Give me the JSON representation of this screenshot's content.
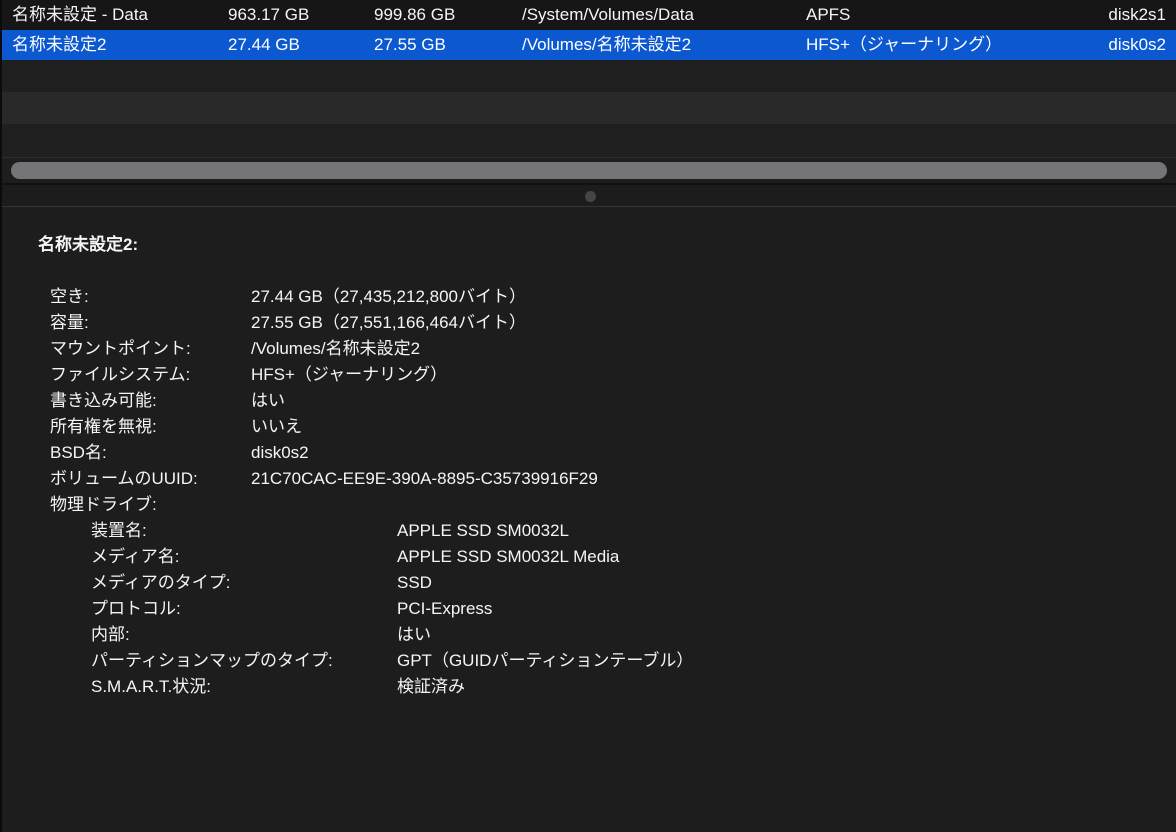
{
  "colors": {
    "selection_blue": "#0b58d0",
    "pane_background": "#1d1d1e",
    "stripe_dark": "#1f1f20",
    "stripe_light": "#29292a",
    "scrollbar_thumb": "#757577",
    "text": "#f5f5f5"
  },
  "table": {
    "rows": [
      {
        "name": "名称未設定 - Data",
        "free": "963.17 GB",
        "capacity": "999.86 GB",
        "mount_point": "/System/Volumes/Data",
        "file_system": "APFS",
        "bsd_name": "disk2s1",
        "selected": false
      },
      {
        "name": "名称未設定2",
        "free": "27.44 GB",
        "capacity": "27.55 GB",
        "mount_point": "/Volumes/名称未設定2",
        "file_system": "HFS+（ジャーナリング）",
        "bsd_name": "disk0s2",
        "selected": true
      }
    ]
  },
  "details": {
    "heading": "名称未設定2:",
    "rows": [
      {
        "label": "空き:",
        "value": "27.44 GB（27,435,212,800バイト）"
      },
      {
        "label": "容量:",
        "value": "27.55 GB（27,551,166,464バイト）"
      },
      {
        "label": "マウントポイント:",
        "value": "/Volumes/名称未設定2"
      },
      {
        "label": "ファイルシステム:",
        "value": "HFS+（ジャーナリング）"
      },
      {
        "label": "書き込み可能:",
        "value": "はい"
      },
      {
        "label": "所有権を無視:",
        "value": "いいえ"
      },
      {
        "label": "BSD名:",
        "value": "disk0s2"
      },
      {
        "label": "ボリュームのUUID:",
        "value": "21C70CAC-EE9E-390A-8895-C35739916F29"
      },
      {
        "label": "物理ドライブ:",
        "value": ""
      },
      {
        "label": "装置名:",
        "value": "APPLE SSD SM0032L"
      },
      {
        "label": "メディア名:",
        "value": "APPLE SSD SM0032L Media"
      },
      {
        "label": "メディアのタイプ:",
        "value": "SSD"
      },
      {
        "label": "プロトコル:",
        "value": "PCI-Express"
      },
      {
        "label": "内部:",
        "value": "はい"
      },
      {
        "label": "パーティションマップのタイプ:",
        "value": "GPT（GUIDパーティションテーブル）"
      },
      {
        "label": "S.M.A.R.T.状況:",
        "value": "検証済み"
      }
    ]
  }
}
